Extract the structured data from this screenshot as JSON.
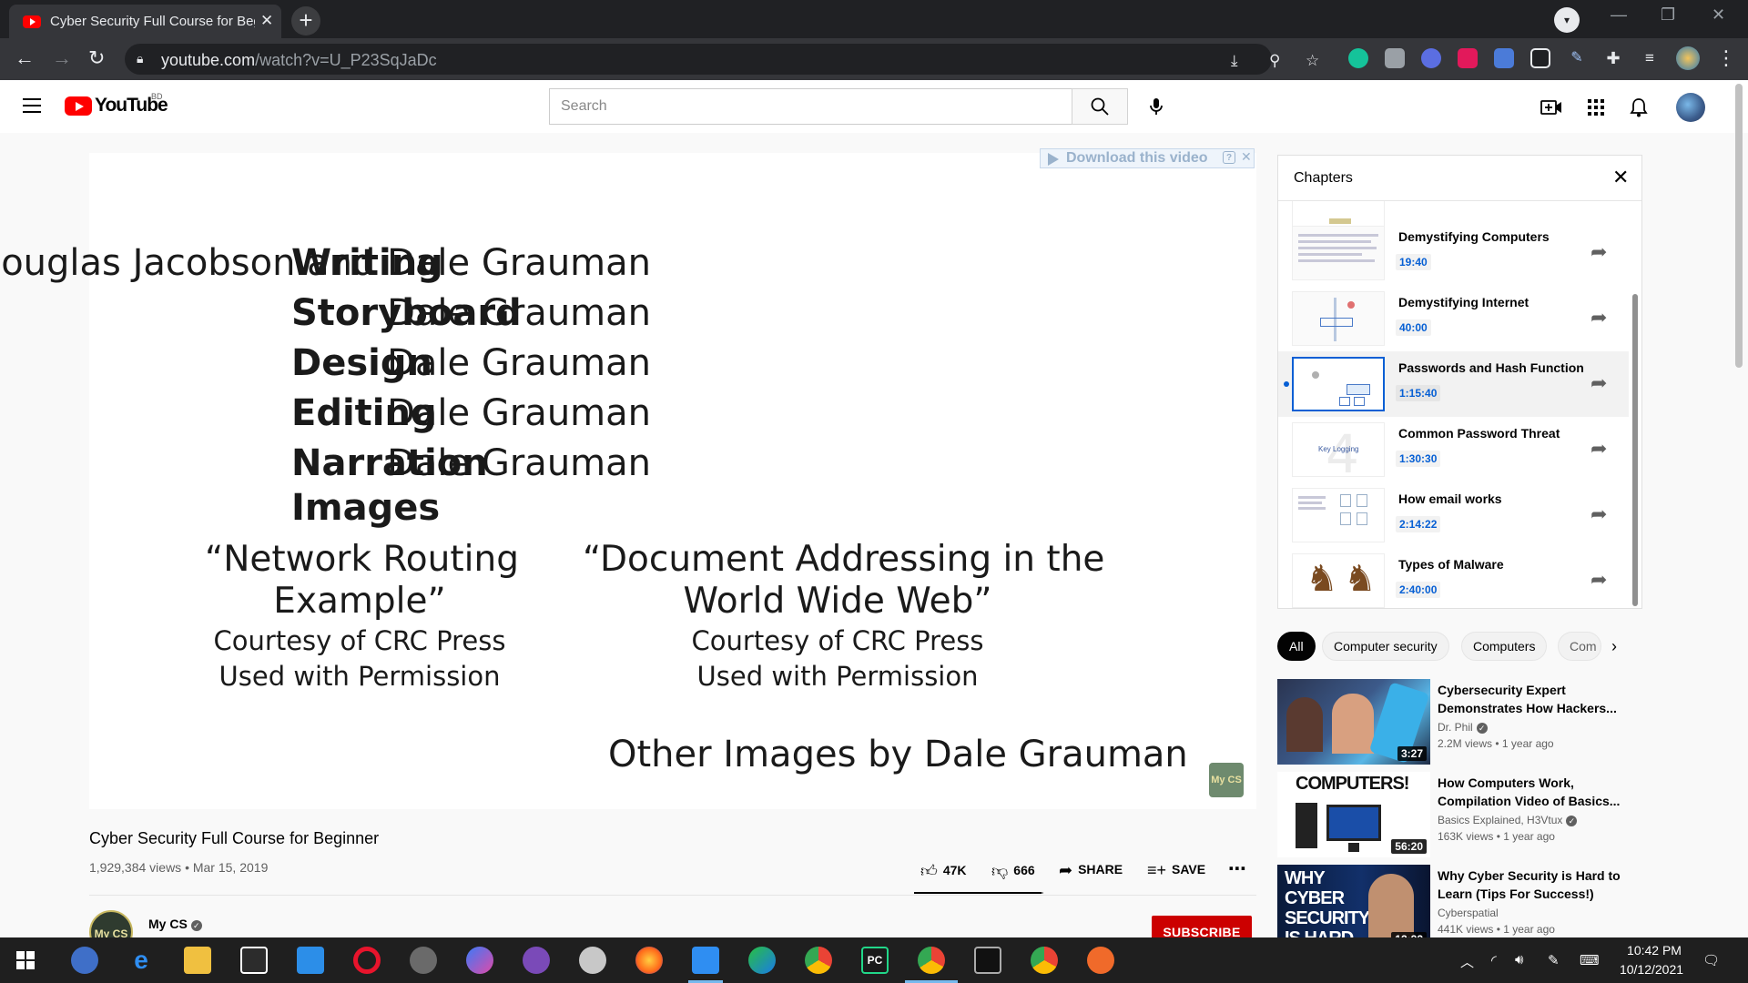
{
  "browser": {
    "tab_title": "Cyber Security Full Course for Beginner",
    "tab_close": "✕",
    "new_tab": "+",
    "url_host": "youtube.com",
    "url_path": "/watch?v=U_P23SqJaDc"
  },
  "youtube": {
    "logo_text": "YouTube",
    "country_code": "BD",
    "search_placeholder": "Search"
  },
  "player": {
    "download_bar": "Download this video",
    "download_help": "?",
    "download_close": "✕",
    "slide": {
      "credits": [
        {
          "role": "Writing",
          "name": "Douglas Jacobson and Dale Grauman"
        },
        {
          "role": "Storyboard",
          "name": "Dale Grauman"
        },
        {
          "role": "Design",
          "name": "Dale Grauman"
        },
        {
          "role": "Editing",
          "name": "Dale Grauman"
        },
        {
          "role": "Narration",
          "name": "Dale Grauman"
        },
        {
          "role": "Images",
          "name": ""
        }
      ],
      "image1_line1": "“Network Routing",
      "image1_line2": "Example”",
      "image2_line1": "“Document Addressing in the",
      "image2_line2": "World Wide Web”",
      "courtesy": "Courtesy of CRC Press",
      "permission": "Used with Permission",
      "other_images": "Other Images by Dale Grauman",
      "badge": "My CS"
    }
  },
  "video": {
    "title": "Cyber Security Full Course for Beginner",
    "meta": "1,929,384 views • Mar 15, 2019",
    "likes": "47K",
    "dislikes": "666",
    "like_ratio": 0.986,
    "share_label": "SHARE",
    "save_label": "SAVE",
    "more": "⋯",
    "channel_name": "My CS",
    "channel_avatar": "My CS",
    "subscribe_label": "SUBSCRIBE"
  },
  "chapters": {
    "title": "Chapters",
    "items": [
      {
        "title": "Demystifying Computers",
        "time": "19:40",
        "active": false
      },
      {
        "title": "Demystifying Internet",
        "time": "40:00",
        "active": false
      },
      {
        "title": "Passwords and Hash Function",
        "time": "1:15:40",
        "active": true
      },
      {
        "title": "Common Password Threat",
        "time": "1:30:30",
        "active": false
      },
      {
        "title": "How email works",
        "time": "2:14:22",
        "active": false
      },
      {
        "title": "Types of Malware",
        "time": "2:40:00",
        "active": false
      }
    ],
    "thumb_label_keylogging": "Key Logging"
  },
  "chips": [
    "All",
    "Computer security",
    "Computers",
    "Com"
  ],
  "recommendations": [
    {
      "title": "Cybersecurity Expert Demonstrates How Hackers...",
      "channel": "Dr. Phil",
      "meta": "2.2M views • 1 year ago",
      "duration": "3:27",
      "verified": true
    },
    {
      "title": "How Computers Work, Compilation Video of Basics...",
      "channel": "Basics Explained, H3Vtux",
      "meta": "163K views • 1 year ago",
      "duration": "56:20",
      "verified": true,
      "thumb_text": "COMPUTERS!"
    },
    {
      "title": "Why Cyber Security is Hard to Learn (Tips For Success!)",
      "channel": "Cyberspatial",
      "meta": "441K views • 1 year ago",
      "duration": "12:22",
      "verified": false,
      "thumb_text": "WHY CYBER SECURITY IS HARD"
    }
  ],
  "taskbar": {
    "time": "10:42 PM",
    "date": "10/12/2021"
  }
}
